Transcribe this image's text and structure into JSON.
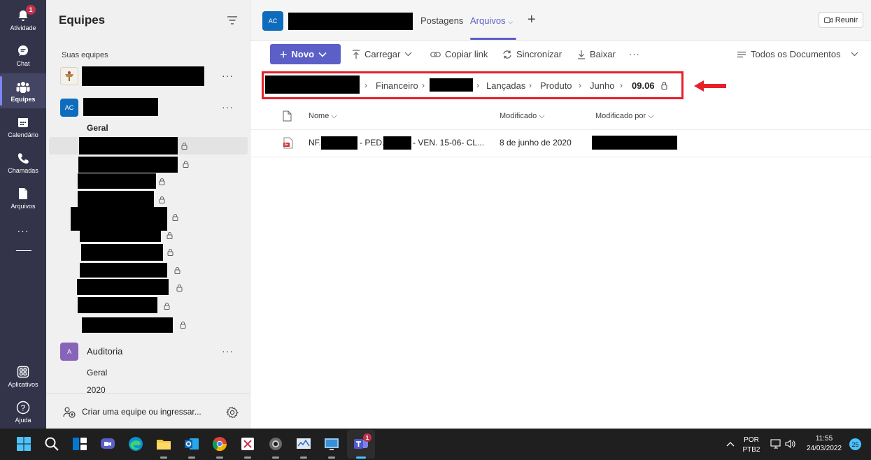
{
  "rail": {
    "items": [
      {
        "label": "Atividade",
        "icon": "bell-icon",
        "badge": "1"
      },
      {
        "label": "Chat",
        "icon": "chat-icon"
      },
      {
        "label": "Equipes",
        "icon": "teams-icon"
      },
      {
        "label": "Calendário",
        "icon": "calendar-icon"
      },
      {
        "label": "Chamadas",
        "icon": "phone-icon"
      },
      {
        "label": "Arquivos",
        "icon": "file-icon"
      },
      {
        "label": "Aplicativos",
        "icon": "apps-icon"
      },
      {
        "label": "Ajuda",
        "icon": "help-icon"
      }
    ],
    "more": "···"
  },
  "panel": {
    "title": "Equipes",
    "section_label": "Suas equipes",
    "team2_avatar": "AC",
    "team2_channel_general": "Geral",
    "team3_avatar": "A",
    "team3_name": "Auditoria",
    "team3_channels": [
      "Geral",
      "2020"
    ],
    "more": "···",
    "footer": "Criar uma equipe ou ingressar..."
  },
  "main": {
    "channel_avatar": "AC",
    "tabs": {
      "posts": "Postagens",
      "files": "Arquivos"
    },
    "plus": "+",
    "meet_label": "Reunir",
    "toolbar": {
      "new_label": "Novo",
      "upload": "Carregar",
      "copy_link": "Copiar link",
      "sync": "Sincronizar",
      "download": "Baixar",
      "more": "···",
      "view": "Todos os Documentos"
    },
    "breadcrumb": [
      "Financeiro",
      "Lançadas",
      "Produto",
      "Junho",
      "09.06"
    ],
    "columns": {
      "name": "Nome",
      "modified": "Modificado",
      "modified_by": "Modificado por"
    },
    "file": {
      "name_a": "NF.",
      "name_b": "- PED.",
      "name_c": "- VEN. 15-06- CL...",
      "modified": "8 de junho de 2020"
    }
  },
  "taskbar": {
    "lang1": "POR",
    "lang2": "PTB2",
    "time": "11:55",
    "date": "24/03/2022",
    "notif_count": "25",
    "teams_badge": "1"
  },
  "colors": {
    "rail_bg": "#33344a",
    "accent": "#5b5fc7",
    "highlight_red": "#e8202a"
  }
}
